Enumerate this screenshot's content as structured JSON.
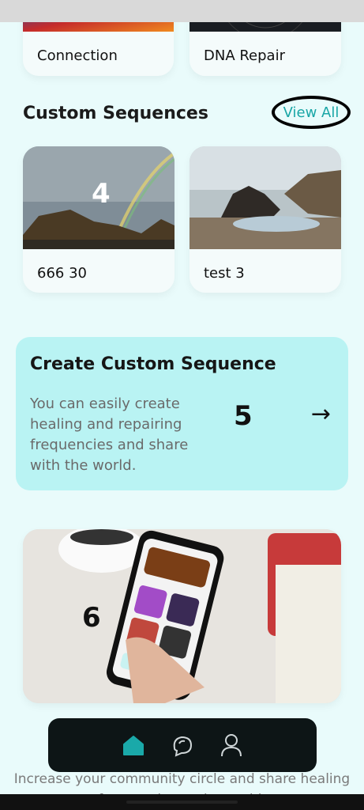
{
  "top_cards": [
    {
      "label": "Connection"
    },
    {
      "label": "DNA Repair"
    }
  ],
  "custom_sequences": {
    "title": "Custom Sequences",
    "view_all": "View All",
    "items": [
      {
        "label": "666 30",
        "overlay": "4"
      },
      {
        "label": "test 3",
        "overlay": ""
      }
    ]
  },
  "create_card": {
    "title": "Create Custom Sequence",
    "description": "You can easily create healing and repairing frequencies and share with the world.",
    "overlay_number": "5",
    "arrow": "→"
  },
  "promo": {
    "overlay_number": "6"
  },
  "nav": {
    "items": [
      {
        "icon": "home-icon"
      },
      {
        "icon": "chat-icon"
      },
      {
        "icon": "profile-icon"
      }
    ]
  },
  "footer": {
    "text": "Increase your community circle and share healing frequencies to the world."
  },
  "colors": {
    "accent": "#19a6a6",
    "create_bg": "#b9f3f3",
    "nav_bg": "#0d1516"
  }
}
